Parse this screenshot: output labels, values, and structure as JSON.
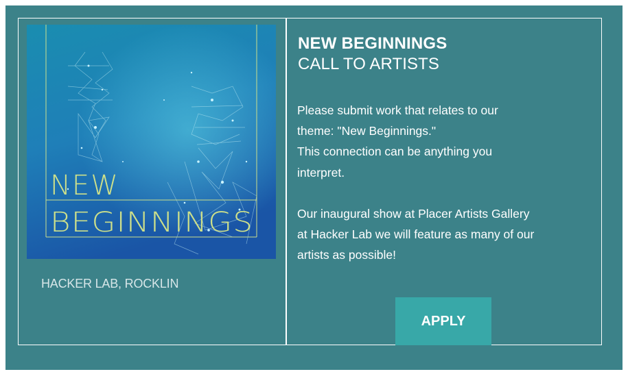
{
  "poster": {
    "word1": "NEW",
    "word2": "BEGINNINGS"
  },
  "location": "HACKER LAB, ROCKLIN",
  "heading": {
    "title": "NEW BEGINNINGS",
    "subtitle": "CALL TO ARTISTS"
  },
  "body": {
    "lines_p1": [
      "Please submit work that relates to our",
      "theme: \"New Beginnings.\"",
      "This connection can be anything you",
      "interpret."
    ],
    "lines_p2": [
      "Our inaugural show at Placer Artists Gallery",
      "at Hacker Lab we will feature as many of our",
      "artists as possible!"
    ]
  },
  "apply_label": "APPLY",
  "colors": {
    "background": "#3c8289",
    "button": "#38a8a8",
    "poster_text": "#cde08a"
  }
}
